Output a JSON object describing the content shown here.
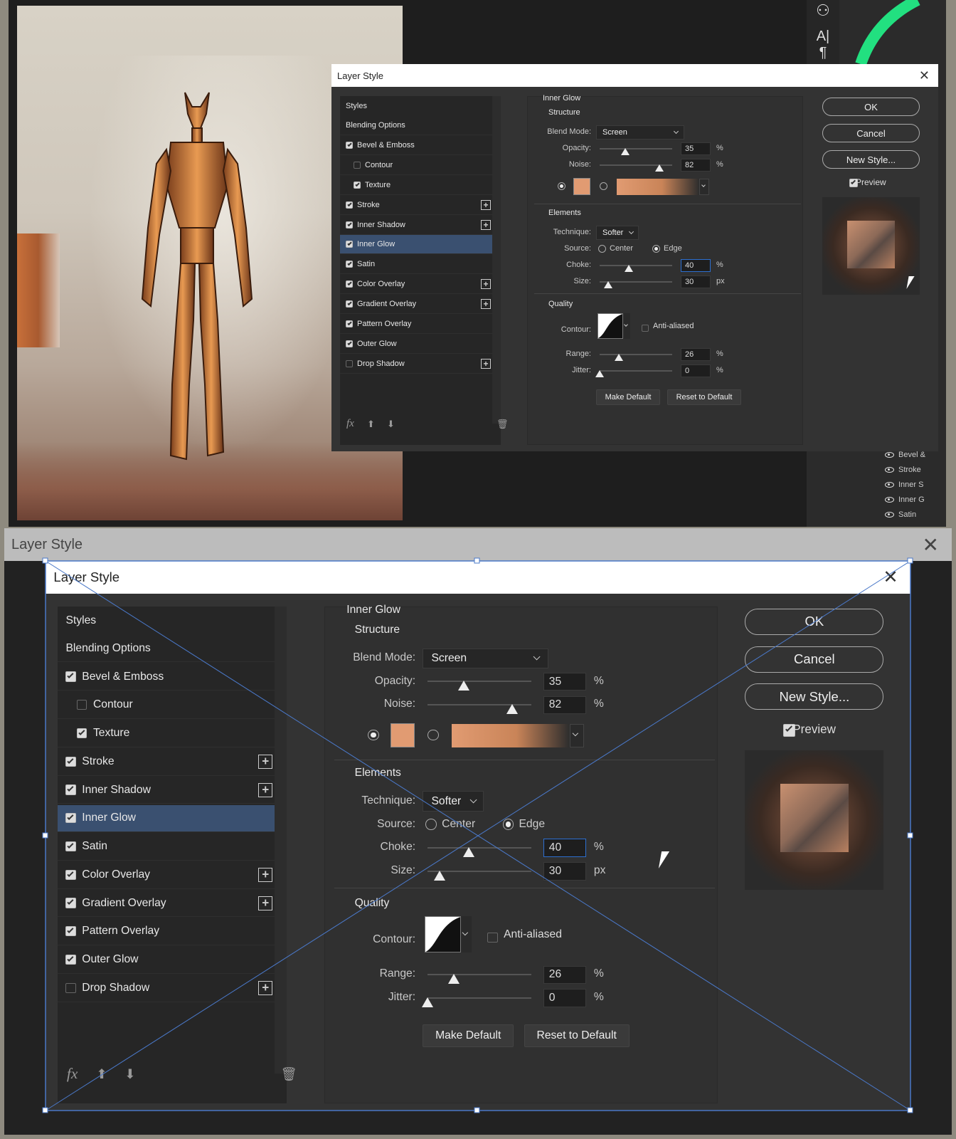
{
  "dialog": {
    "title": "Layer Style",
    "styles_header": "Styles",
    "items": [
      {
        "label": "Blending Options",
        "checkbox": null,
        "plus": false,
        "indent": false,
        "selected": false
      },
      {
        "label": "Bevel & Emboss",
        "checkbox": true,
        "plus": false,
        "indent": false,
        "selected": false
      },
      {
        "label": "Contour",
        "checkbox": false,
        "plus": false,
        "indent": true,
        "selected": false
      },
      {
        "label": "Texture",
        "checkbox": true,
        "plus": false,
        "indent": true,
        "selected": false
      },
      {
        "label": "Stroke",
        "checkbox": true,
        "plus": true,
        "indent": false,
        "selected": false
      },
      {
        "label": "Inner Shadow",
        "checkbox": true,
        "plus": true,
        "indent": false,
        "selected": false
      },
      {
        "label": "Inner Glow",
        "checkbox": true,
        "plus": false,
        "indent": false,
        "selected": true
      },
      {
        "label": "Satin",
        "checkbox": true,
        "plus": false,
        "indent": false,
        "selected": false
      },
      {
        "label": "Color Overlay",
        "checkbox": true,
        "plus": true,
        "indent": false,
        "selected": false
      },
      {
        "label": "Gradient Overlay",
        "checkbox": true,
        "plus": true,
        "indent": false,
        "selected": false
      },
      {
        "label": "Pattern Overlay",
        "checkbox": true,
        "plus": false,
        "indent": false,
        "selected": false
      },
      {
        "label": "Outer Glow",
        "checkbox": true,
        "plus": false,
        "indent": false,
        "selected": false
      },
      {
        "label": "Drop Shadow",
        "checkbox": false,
        "plus": true,
        "indent": false,
        "selected": false
      }
    ],
    "footer": {
      "fx": "fx"
    },
    "inner_glow": {
      "title": "Inner Glow",
      "structure": "Structure",
      "blend_mode_label": "Blend Mode:",
      "blend_mode": "Screen",
      "opacity_label": "Opacity:",
      "opacity": "35",
      "opacity_fraction": 0.35,
      "noise_label": "Noise:",
      "noise": "82",
      "noise_fraction": 0.82,
      "glow_color": "#e19b72",
      "elements": "Elements",
      "technique_label": "Technique:",
      "technique": "Softer",
      "source_label": "Source:",
      "source_center": "Center",
      "source_edge": "Edge",
      "choke_label": "Choke:",
      "choke": "40",
      "choke_fraction": 0.4,
      "size_label": "Size:",
      "size": "30",
      "size_fraction": 0.12,
      "quality": "Quality",
      "contour_label": "Contour:",
      "anti_aliased": "Anti-aliased",
      "range_label": "Range:",
      "range": "26",
      "range_fraction": 0.26,
      "jitter_label": "Jitter:",
      "jitter": "0",
      "jitter_fraction": 0,
      "percent": "%",
      "px": "px",
      "make_default": "Make Default",
      "reset_default": "Reset to Default"
    },
    "buttons": {
      "ok": "OK",
      "cancel": "Cancel",
      "new_style": "New Style...",
      "preview": "Preview"
    }
  },
  "background_dialog_title": "Layer Style",
  "layers_panel": [
    "Bevel &",
    "Stroke",
    "Inner S",
    "Inner G",
    "Satin"
  ],
  "colors": {
    "selection": "#3a5070",
    "accent_blue": "#2d6fd0",
    "glow": "#e19b72"
  }
}
